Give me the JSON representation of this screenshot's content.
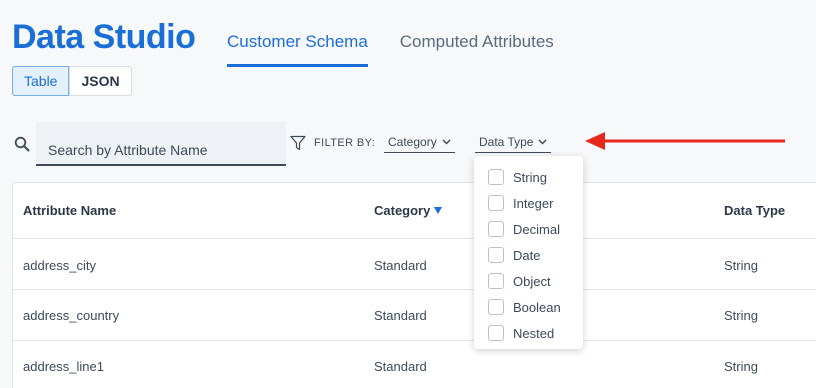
{
  "app": {
    "title": "Data Studio"
  },
  "tabs": [
    {
      "label": "Customer Schema",
      "active": true
    },
    {
      "label": "Computed Attributes",
      "active": false
    }
  ],
  "view_toggle": {
    "table_label": "Table",
    "json_label": "JSON",
    "selected": "Table"
  },
  "search": {
    "placeholder": "Search by Attribute Name",
    "value": ""
  },
  "filter": {
    "label": "FILTER BY:",
    "dropdowns": [
      {
        "label": "Category"
      },
      {
        "label": "Data Type",
        "open": true
      }
    ]
  },
  "data_type_menu": {
    "options": [
      {
        "label": "String",
        "checked": false
      },
      {
        "label": "Integer",
        "checked": false
      },
      {
        "label": "Decimal",
        "checked": false
      },
      {
        "label": "Date",
        "checked": false
      },
      {
        "label": "Object",
        "checked": false
      },
      {
        "label": "Boolean",
        "checked": false
      },
      {
        "label": "Nested",
        "checked": false
      }
    ]
  },
  "table": {
    "columns": [
      "Attribute Name",
      "Category",
      "Data Type"
    ],
    "sorted_column": "Category",
    "rows": [
      [
        "address_city",
        "Standard",
        "String"
      ],
      [
        "address_country",
        "Standard",
        "String"
      ],
      [
        "address_line1",
        "Standard",
        "String"
      ]
    ]
  },
  "colors": {
    "accent": "#1a6ed8",
    "annotation_arrow": "#e8281b"
  }
}
